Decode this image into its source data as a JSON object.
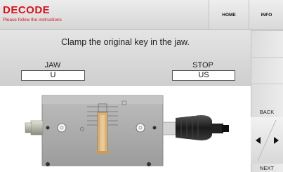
{
  "header": {
    "title": "DECODE",
    "subtitle": "Please follow the instructions",
    "home_label": "HOME",
    "info_label": "INFO"
  },
  "instruction": "Clamp the original key in the jaw.",
  "jaw": {
    "label": "JAW",
    "value": "U"
  },
  "stop": {
    "label": "STOP",
    "value": "US"
  },
  "nav": {
    "back_label": "BACK",
    "next_label": "NEXT"
  },
  "colors": {
    "accent": "#d6121b",
    "key": "#d8b17a",
    "body": "#a9a9a9"
  },
  "icons": {
    "prev": "triangle-left-icon",
    "next": "triangle-right-icon"
  }
}
